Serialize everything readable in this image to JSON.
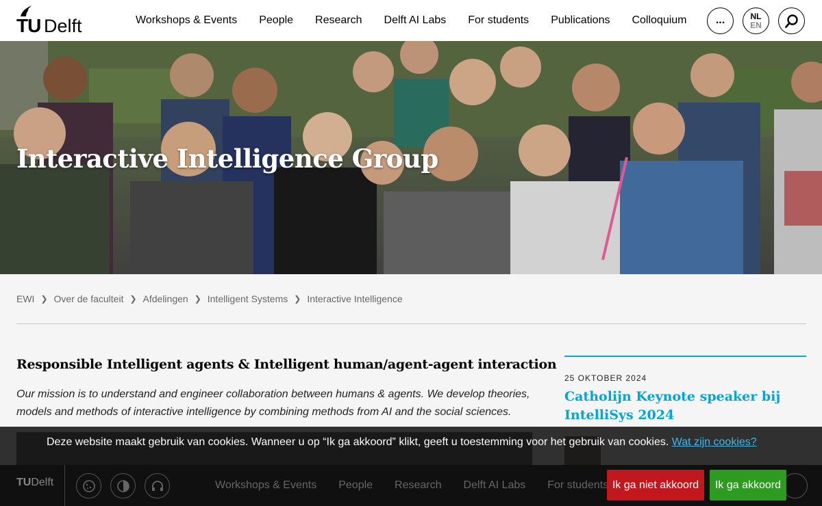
{
  "header": {
    "logo_tu": "TU",
    "logo_delft": "Delft",
    "nav": [
      "Workshops & Events",
      "People",
      "Research",
      "Delft AI Labs",
      "For students",
      "Publications",
      "Colloquium"
    ],
    "more_label": "...",
    "lang_primary": "NL",
    "lang_secondary": "EN"
  },
  "hero": {
    "title": "Interactive Intelligence Group"
  },
  "breadcrumb": [
    "EWI",
    "Over de faculteit",
    "Afdelingen",
    "Intelligent Systems",
    "Interactive Intelligence"
  ],
  "main": {
    "title": "Responsible Intelligent agents & Intelligent human/agent-agent interaction",
    "mission": "Our mission is to understand and engineer collaboration between humans & agents. We develop theories, models and methods of interactive intelligence by combining methods from AI and the social sciences."
  },
  "news": {
    "date": "25 OKTOBER 2024",
    "title": "Catholijn Keynote speaker bij IntelliSys 2024"
  },
  "cookie": {
    "text": "Deze website maakt gebruik van cookies. Wanneer u op “Ik ga akkoord” klikt, geeft u toestemming voor het gebruik van cookies.",
    "link": "Wat zijn cookies?",
    "decline_label": "Ik ga niet akkoord",
    "accept_label": "Ik ga akkoord"
  },
  "footer_nav": [
    "Workshops & Events",
    "People",
    "Research",
    "Delft AI Labs",
    "For students"
  ],
  "colors": {
    "accent": "#00a6d6",
    "decline": "#c3171e",
    "accept": "#2d9b1f"
  }
}
